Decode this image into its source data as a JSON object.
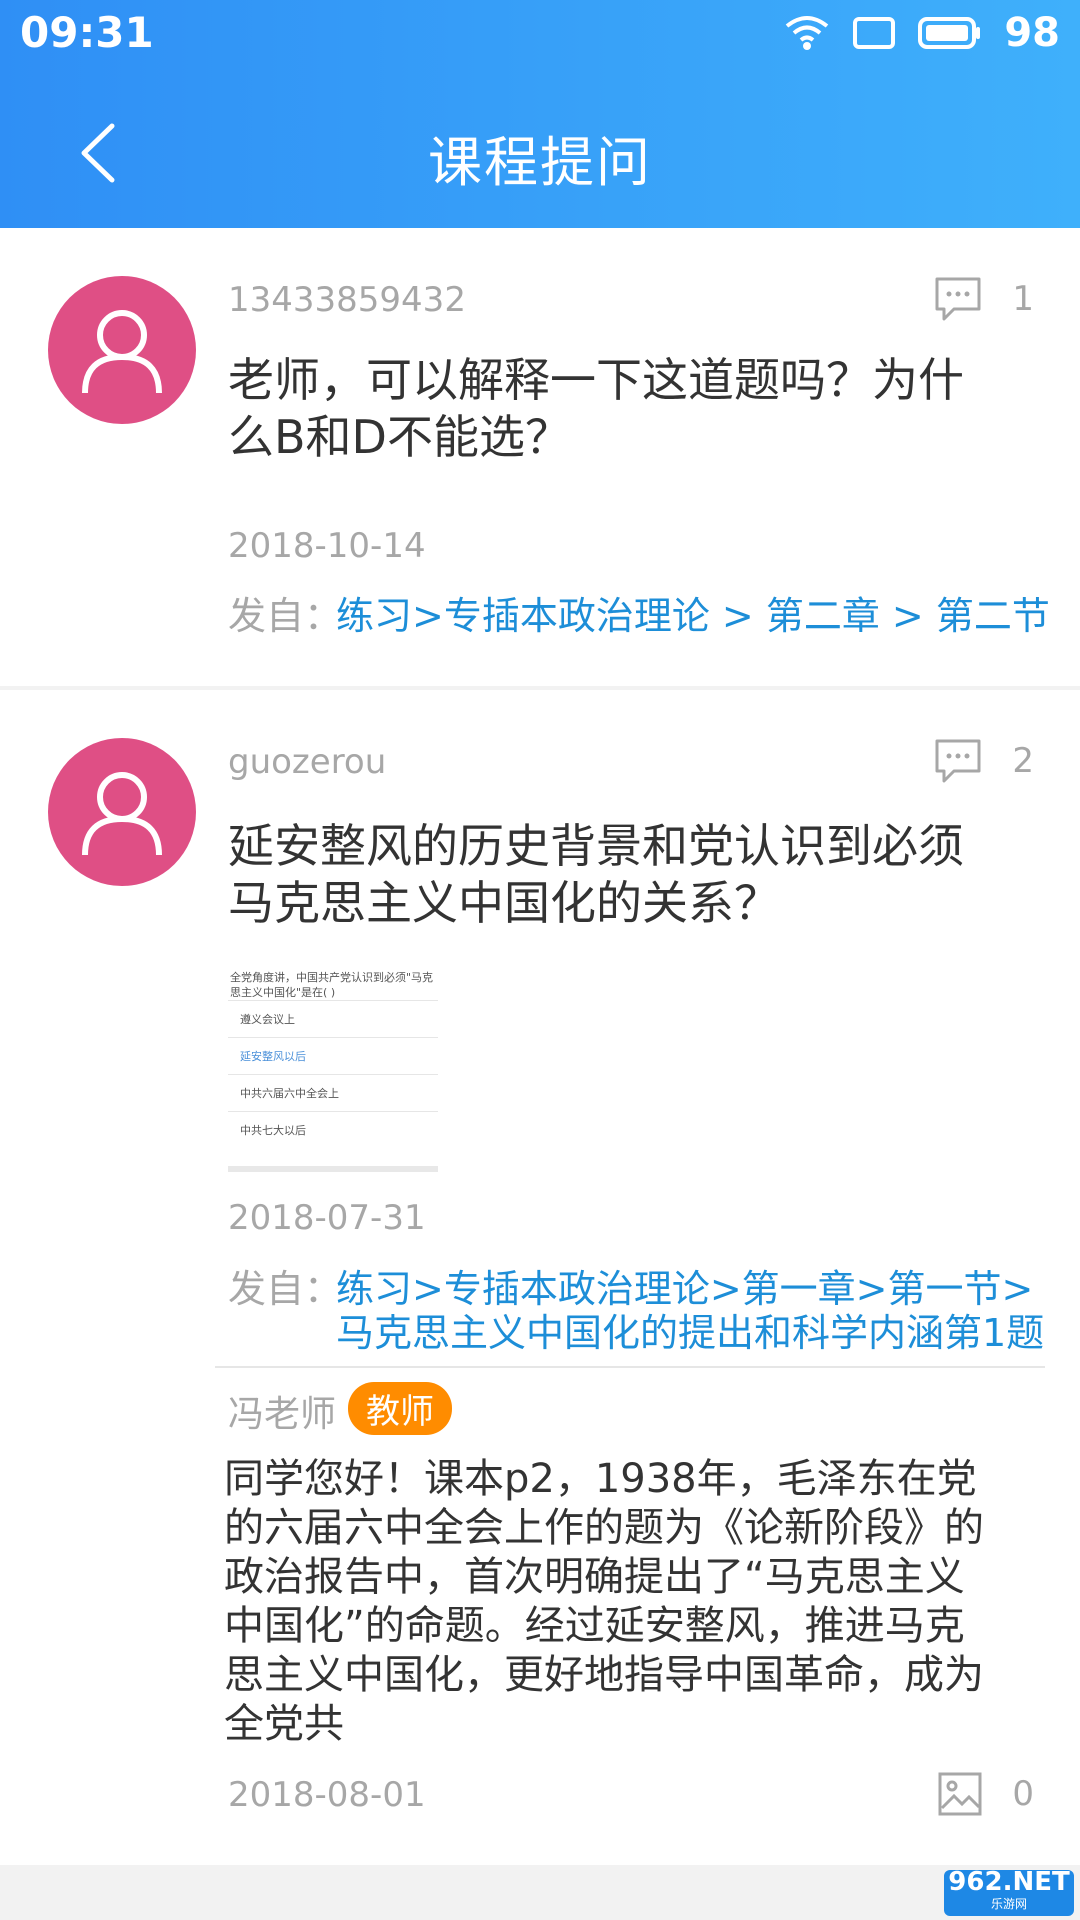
{
  "status_bar": {
    "time": "09:31",
    "battery": "98"
  },
  "header": {
    "title": "课程提问"
  },
  "posts": [
    {
      "username": "13433859432",
      "comment_count": "1",
      "question": "老师，可以解释一下这道题吗？为什么B和D不能选？",
      "date": "2018-10-14",
      "source_label": "发自：",
      "source": "练习>专插本政治理论 > 第二章 > 第二节"
    },
    {
      "username": "guozerou",
      "comment_count": "2",
      "question": "延安整风的历史背景和党认识到必须马克思主义中国化的关系？",
      "thumbnail": {
        "question": "全党角度讲，中国共产党认识到必须\"马克思主义中国化\"是在( )",
        "options": [
          "遵义会议上",
          "延安整风以后",
          "中共六届六中全会上",
          "中共七大以后"
        ]
      },
      "date": "2018-07-31",
      "source_label": "发自：",
      "source": "练习>专插本政治理论>第一章>第一节>马克思主义中国化的提出和科学内涵第1题",
      "reply": {
        "teacher_name": "冯老师",
        "badge": "教师",
        "text": "同学您好！课本p2，1938年，毛泽东在党的六届六中全会上作的题为《论新阶段》的政治报告中，首次明确提出了“马克思主义中国化”的命题。经过延安整风，推进马克思主义中国化，更好地指导中国革命，成为全党共",
        "date": "2018-08-01",
        "image_count": "0"
      }
    }
  ],
  "watermark": {
    "text": "962.NET",
    "sub": "乐游网"
  }
}
